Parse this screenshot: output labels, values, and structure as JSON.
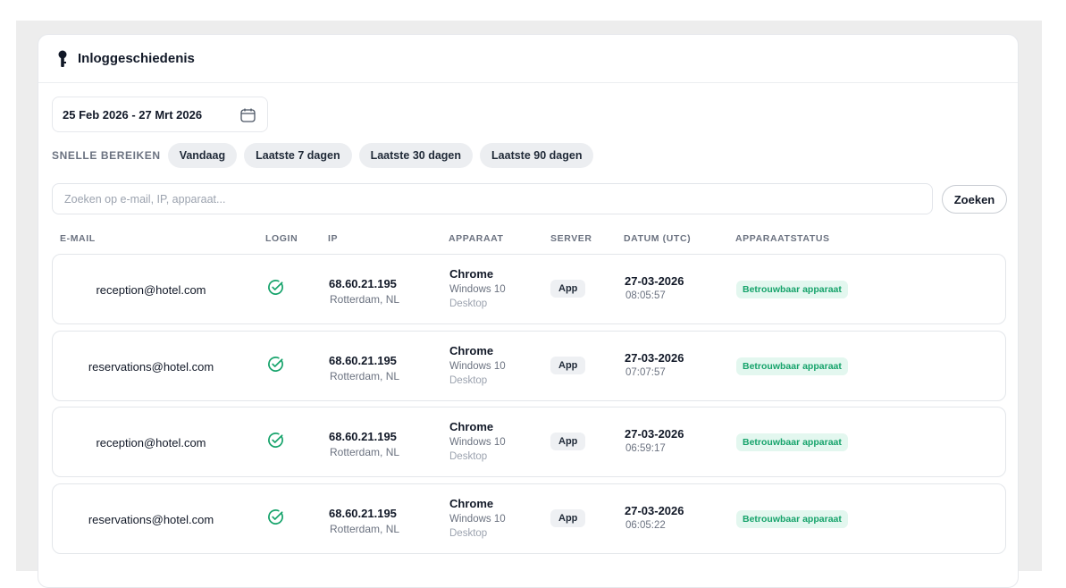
{
  "header": {
    "title": "Inloggeschiedenis",
    "icon": "key-icon"
  },
  "date_range": {
    "label": "25 Feb 2026 - 27 Mrt 2026",
    "icon": "calendar-icon"
  },
  "quick_ranges": {
    "label": "SNELLE BEREIKEN",
    "options": [
      "Vandaag",
      "Laatste 7 dagen",
      "Laatste 30 dagen",
      "Laatste 90 dagen"
    ]
  },
  "search": {
    "placeholder": "Zoeken op e-mail, IP, apparaat...",
    "value": "",
    "button_label": "Zoeken"
  },
  "columns": [
    "E-MAIL",
    "LOGIN",
    "IP",
    "APPARAAT",
    "SERVER",
    "DATUM (UTC)",
    "APPARAATSTATUS"
  ],
  "rows": [
    {
      "email": "reception@hotel.com",
      "login": "success-icon",
      "ip": "68.60.21.195",
      "location": "Rotterdam, NL",
      "browser": "Chrome",
      "os": "Windows 10",
      "device_type": "Desktop",
      "server": "App",
      "date": "27-03-2026",
      "time": "08:05:57",
      "status": "Betrouwbaar apparaat"
    },
    {
      "email": "reservations@hotel.com",
      "login": "success-icon",
      "ip": "68.60.21.195",
      "location": "Rotterdam, NL",
      "browser": "Chrome",
      "os": "Windows 10",
      "device_type": "Desktop",
      "server": "App",
      "date": "27-03-2026",
      "time": "07:07:57",
      "status": "Betrouwbaar apparaat"
    },
    {
      "email": "reception@hotel.com",
      "login": "success-icon",
      "ip": "68.60.21.195",
      "location": "Rotterdam, NL",
      "browser": "Chrome",
      "os": "Windows 10",
      "device_type": "Desktop",
      "server": "App",
      "date": "27-03-2026",
      "time": "06:59:17",
      "status": "Betrouwbaar apparaat"
    },
    {
      "email": "reservations@hotel.com",
      "login": "success-icon",
      "ip": "68.60.21.195",
      "location": "Rotterdam, NL",
      "browser": "Chrome",
      "os": "Windows 10",
      "device_type": "Desktop",
      "server": "App",
      "date": "27-03-2026",
      "time": "06:05:22",
      "status": "Betrouwbaar apparaat"
    }
  ],
  "colors": {
    "success": "#16a36b",
    "badge_success_bg": "#e3f7ef",
    "chip_bg": "#eceef1"
  }
}
